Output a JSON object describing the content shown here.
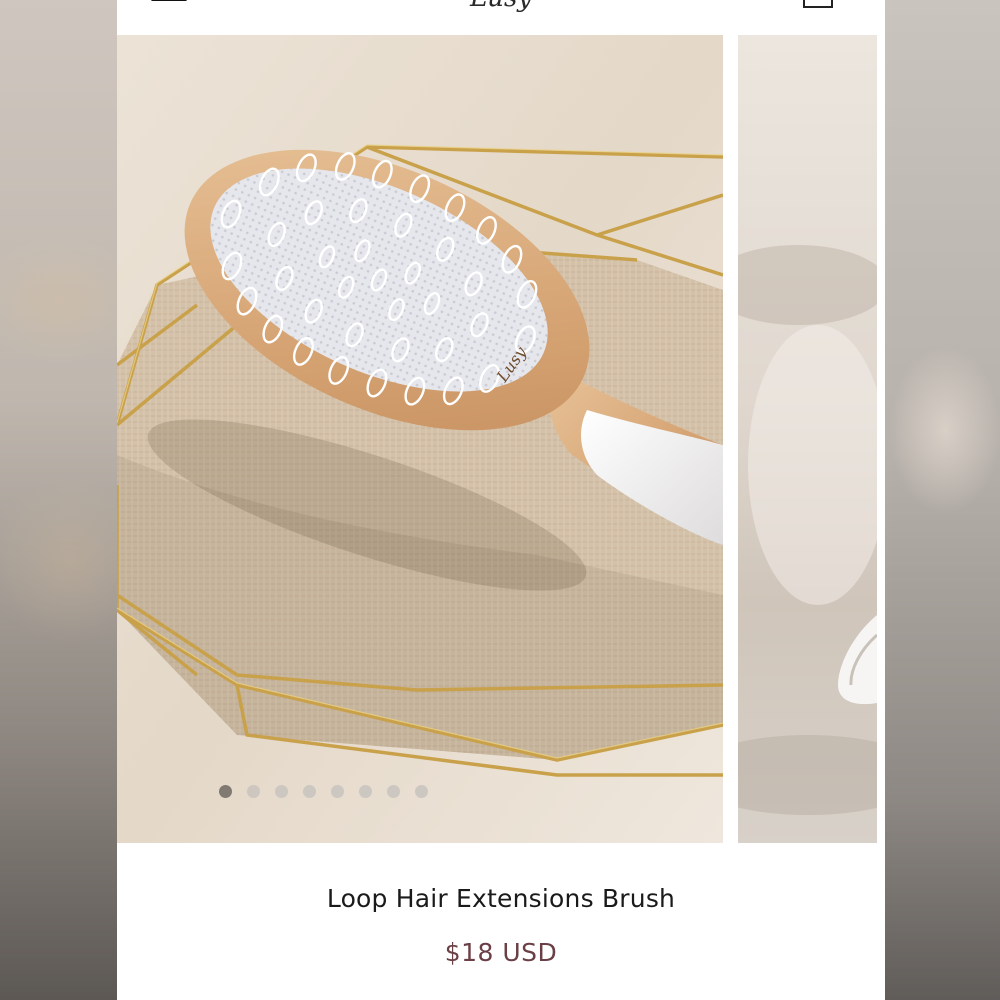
{
  "header": {
    "menu_icon": "hamburger-menu-icon",
    "logo_text": "Lusy",
    "cart_icon": "shopping-bag-icon"
  },
  "carousel": {
    "slide_count": 8,
    "active_index": 0,
    "colors": {
      "background": "#e7ddd0",
      "linen": "#cdbba3",
      "gold": "#c9a14a",
      "wood": "#d7a97a",
      "bristle_pad": "#dcdde3",
      "handle": "#f1efef",
      "dot_active": "#6e6964",
      "dot_inactive": "#c8c3be"
    },
    "brush_logo_text": "Lusy"
  },
  "product": {
    "title": "Loop Hair Extensions Brush",
    "price": "$18 USD",
    "price_color": "#6b3f46"
  }
}
